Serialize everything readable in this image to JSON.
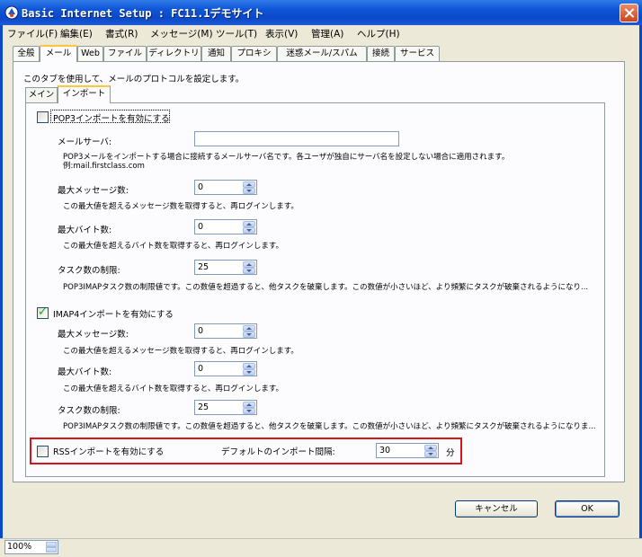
{
  "window": {
    "title": "Basic Internet Setup : FC11.1デモサイト",
    "icon": "app-icon",
    "close_icon": "close-icon"
  },
  "menubar": {
    "items": [
      {
        "label": "ファイル(F)"
      },
      {
        "label": "編集(E)"
      },
      {
        "label": "書式(R)"
      },
      {
        "label": "メッセージ(M)"
      },
      {
        "label": "ツール(T)"
      },
      {
        "label": "表示(V)"
      },
      {
        "label": "管理(A)"
      },
      {
        "label": "ヘルプ(H)"
      }
    ]
  },
  "tabs": [
    {
      "label": "全般"
    },
    {
      "label": "メール",
      "active": true
    },
    {
      "label": "Web"
    },
    {
      "label": "ファイル"
    },
    {
      "label": "ディレクトリ"
    },
    {
      "label": "通知"
    },
    {
      "label": "プロキシ"
    },
    {
      "label": "迷惑メール/スパム"
    },
    {
      "label": "接続"
    },
    {
      "label": "サービス"
    }
  ],
  "mail": {
    "description": "このタブを使用して、メールのプロトコルを設定します。",
    "subtabs": [
      {
        "label": "メイン"
      },
      {
        "label": "インポート",
        "active": true
      }
    ]
  },
  "pop3": {
    "enable_label": "POP3インポートを有効にする",
    "enabled": false,
    "server_label": "メールサーバ:",
    "server_value": "",
    "server_hint_1": "POP3メールをインポートする場合に接続するメールサーバ名です。各ユーザが独自にサーバ名を設定しない場合に適用されます。",
    "server_hint_2": "例:mail.firstclass.com",
    "max_messages_label": "最大メッセージ数:",
    "max_messages_value": "0",
    "max_messages_hint": "この最大値を超えるメッセージ数を取得すると、再ログインします。",
    "max_bytes_label": "最大バイト数:",
    "max_bytes_value": "0",
    "max_bytes_hint": "この最大値を超えるバイト数を取得すると、再ログインします。",
    "task_limit_label": "タスク数の制限:",
    "task_limit_value": "25",
    "task_limit_hint": "POP3IMAPタスク数の制限値です。この数値を超過すると、他タスクを破棄します。この数値が小さいほど、より頻繁にタスクが破棄されるようになり..."
  },
  "imap4": {
    "enable_label": "IMAP4インポートを有効にする",
    "enabled": true,
    "max_messages_label": "最大メッセージ数:",
    "max_messages_value": "0",
    "max_messages_hint": "この最大値を超えるメッセージ数を取得すると、再ログインします。",
    "max_bytes_label": "最大バイト数:",
    "max_bytes_value": "0",
    "max_bytes_hint": "この最大値を超えるバイト数を取得すると、再ログインします。",
    "task_limit_label": "タスク数の制限:",
    "task_limit_value": "25",
    "task_limit_hint": "POP3IMAPタスク数の制限値です。この数値を超過すると、他タスクを破棄します。この数値が小さいほど、より頻繁にタスクが破棄されるようになりま..."
  },
  "rss": {
    "enable_label": "RSSインポートを有効にする",
    "enabled": false,
    "interval_label": "デフォルトのインポート間隔:",
    "interval_value": "30",
    "interval_unit": "分"
  },
  "buttons": {
    "cancel": "キャンセル",
    "ok": "OK"
  },
  "status": {
    "zoom": "100%"
  },
  "colors": {
    "titlebar": "#0a48c9",
    "highlight_box": "#d8131b",
    "check": "#21a121"
  }
}
